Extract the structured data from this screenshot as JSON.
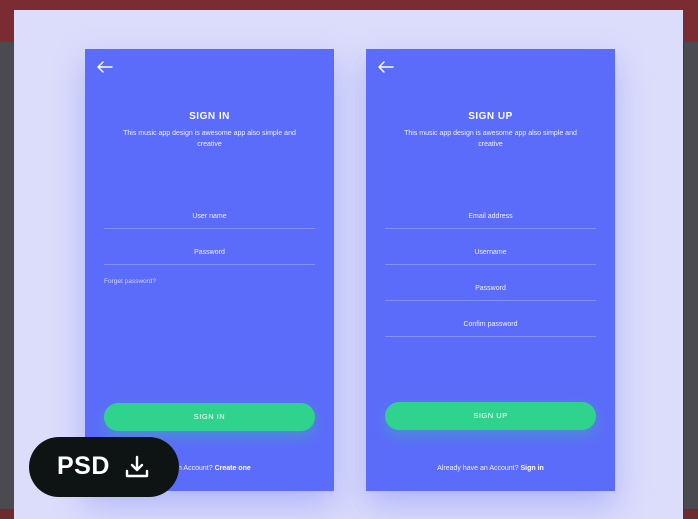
{
  "signin": {
    "title": "SIGN IN",
    "subtitle": "This music app design is awesome app also simple and creative",
    "fields": [
      "User name",
      "Password"
    ],
    "forgot": "Forget password?",
    "button": "SIGN IN",
    "footer_text": "e an Account?",
    "footer_link": "Create one"
  },
  "signup": {
    "title": "SIGN UP",
    "subtitle": "This music app design is awesome app also simple and creative",
    "fields": [
      "Email address",
      "Username",
      "Password",
      "Confim password"
    ],
    "button": "SIGN UP",
    "footer_text": "Already have an Account?",
    "footer_link": "Sign in"
  },
  "badge": {
    "label": "PSD",
    "icon": "download-icon"
  },
  "colors": {
    "panel": "#5c6cfa",
    "button": "#2fd38e",
    "backdrop": "#dcdcfb",
    "badge": "#0d1413"
  }
}
